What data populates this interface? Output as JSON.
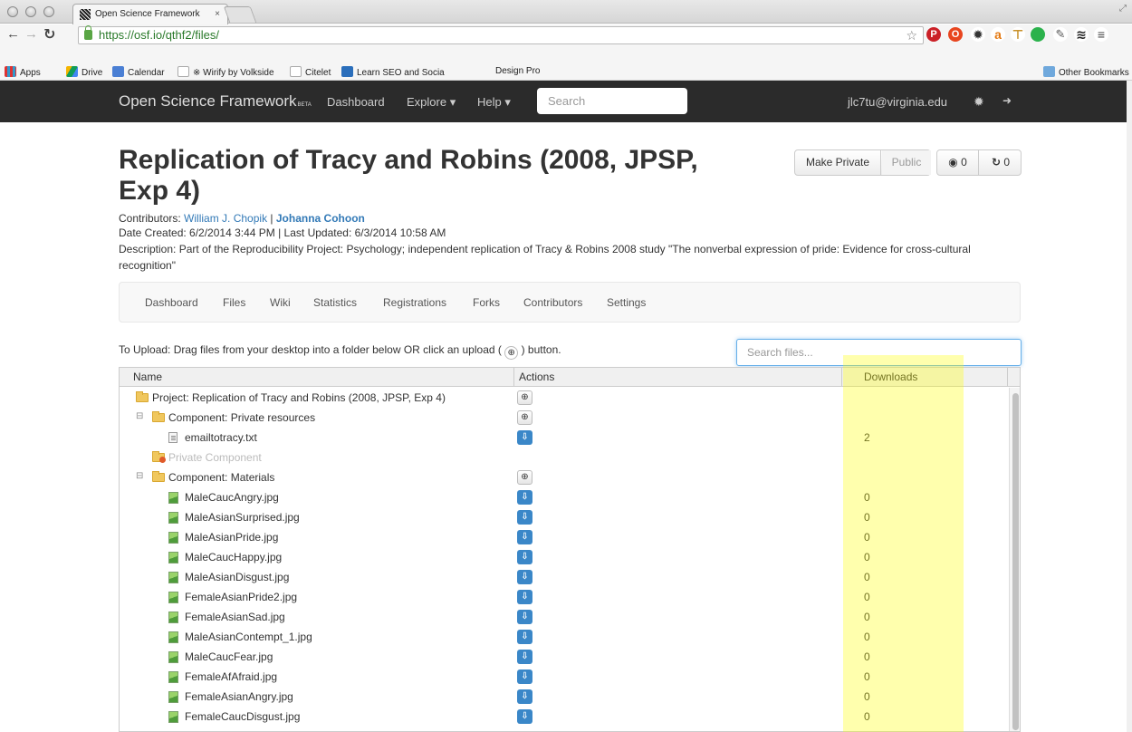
{
  "browser": {
    "tab_title": "Open Science Framework",
    "tab_close": "×",
    "url": "https://osf.io/qthf2/files/",
    "star_glyph": "☆",
    "corner_glyph": "⤢",
    "bookmarks": [
      "Apps",
      "Drive",
      "Calendar",
      "※ Wirify by Volkside",
      "Citelet",
      "Learn SEO and Socia",
      "Design Pro",
      "Other Bookmarks"
    ]
  },
  "osf_nav": {
    "brand": "Open Science Framework",
    "brand_suffix": "BETA",
    "links": {
      "dashboard": "Dashboard",
      "explore": "Explore ▾",
      "help": "Help ▾"
    },
    "search_placeholder": "Search",
    "user": "jlc7tu@virginia.edu",
    "settings_icon": "✹",
    "logout_icon": "➜"
  },
  "project": {
    "title": "Replication of Tracy and Robins (2008, JPSP, Exp 4)",
    "contributors_label": "Contributors:",
    "contributor_1": "William J. Chopik",
    "contributor_separator": "|",
    "contributor_2": "Johanna Cohoon",
    "dates": "Date Created: 6/2/2014 3:44 PM | Last Updated: 6/3/2014 10:58 AM",
    "description": "Description: Part of the Reproducibility Project: Psychology; independent replication of Tracy & Robins 2008 study \"The nonverbal expression of pride: Evidence for cross-cultural recognition\"",
    "buttons": {
      "make_private": "Make Private",
      "public": "Public",
      "watch_count": "0",
      "fork_count": "0"
    },
    "tabs": [
      "Dashboard",
      "Files",
      "Wiki",
      "Statistics",
      "Registrations",
      "Forks",
      "Contributors",
      "Settings"
    ]
  },
  "files": {
    "upload_note_before": "To Upload: Drag files from your desktop into a folder below OR click an upload (",
    "upload_note_after": ") button.",
    "search_placeholder": "Search files...",
    "columns": {
      "name": "Name",
      "actions": "Actions",
      "downloads": "Downloads"
    },
    "rows": [
      {
        "name": "Project: Replication of Tracy and Robins (2008, JPSP, Exp 4)",
        "kind": "folder",
        "action": "upload",
        "downloads": ""
      },
      {
        "name": "Component: Private resources",
        "kind": "folder",
        "action": "upload",
        "downloads": ""
      },
      {
        "name": "emailtotracy.txt",
        "kind": "file",
        "action": "download",
        "downloads": "2"
      },
      {
        "name": "Private Component",
        "kind": "private",
        "action": "",
        "downloads": ""
      },
      {
        "name": "Component: Materials",
        "kind": "folder",
        "action": "upload",
        "downloads": ""
      },
      {
        "name": "MaleCaucAngry.jpg",
        "kind": "image",
        "action": "download",
        "downloads": "0"
      },
      {
        "name": "MaleAsianSurprised.jpg",
        "kind": "image",
        "action": "download",
        "downloads": "0"
      },
      {
        "name": "MaleAsianPride.jpg",
        "kind": "image",
        "action": "download",
        "downloads": "0"
      },
      {
        "name": "MaleCaucHappy.jpg",
        "kind": "image",
        "action": "download",
        "downloads": "0"
      },
      {
        "name": "MaleAsianDisgust.jpg",
        "kind": "image",
        "action": "download",
        "downloads": "0"
      },
      {
        "name": "FemaleAsianPride2.jpg",
        "kind": "image",
        "action": "download",
        "downloads": "0"
      },
      {
        "name": "FemaleAsianSad.jpg",
        "kind": "image",
        "action": "download",
        "downloads": "0"
      },
      {
        "name": "MaleAsianContempt_1.jpg",
        "kind": "image",
        "action": "download",
        "downloads": "0"
      },
      {
        "name": "MaleCaucFear.jpg",
        "kind": "image",
        "action": "download",
        "downloads": "0"
      },
      {
        "name": "FemaleAfAfraid.jpg",
        "kind": "image",
        "action": "download",
        "downloads": "0"
      },
      {
        "name": "FemaleAsianAngry.jpg",
        "kind": "image",
        "action": "download",
        "downloads": "0"
      },
      {
        "name": "FemaleCaucDisgust.jpg",
        "kind": "image",
        "action": "download",
        "downloads": "0"
      }
    ],
    "expander_glyph": "⊟",
    "upload_glyph": "⊕",
    "download_glyph": "⇩"
  },
  "colors": {
    "navbar": "#2b2b2b",
    "link": "#337ab7",
    "download_button": "#3a87c8",
    "highlight": "#ffff00"
  }
}
